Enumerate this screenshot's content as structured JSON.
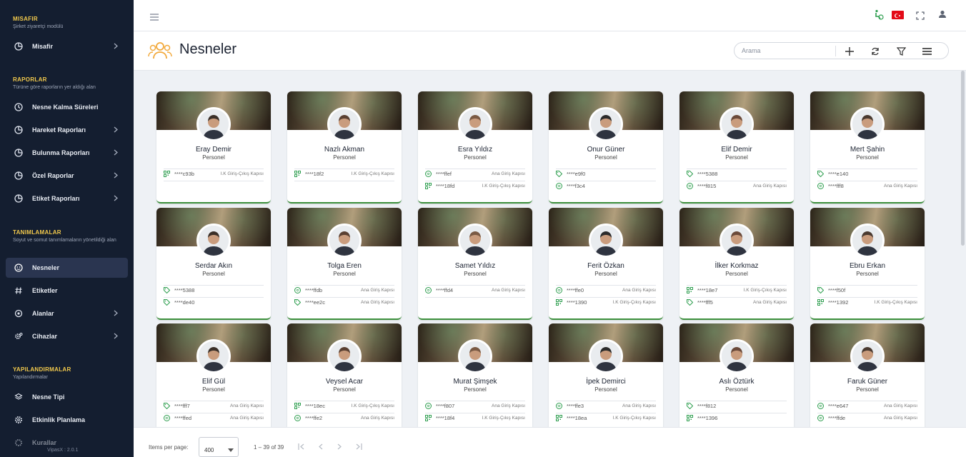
{
  "sidebar": {
    "sections": [
      {
        "title": "MISAFIR",
        "subtitle": "Şirket ziyaretçi modülü"
      },
      {
        "title": "RAPORLAR",
        "subtitle": "Türüne göre raporların yer aldığı alan"
      },
      {
        "title": "TANIMLAMALAR",
        "subtitle": "Soyut ve somut tanımlamaların yönetildiği alan"
      },
      {
        "title": "YAPILANDIRMALAR",
        "subtitle": "Yapılandırmalar"
      }
    ],
    "items": [
      {
        "label": "Misafir",
        "icon": "pie-chart-icon"
      },
      {
        "label": "Nesne Kalma Süreleri",
        "icon": "clock-icon"
      },
      {
        "label": "Hareket Raporları",
        "icon": "pie-chart-icon"
      },
      {
        "label": "Bulunma Raporları",
        "icon": "pie-chart-icon"
      },
      {
        "label": "Özel Raporlar",
        "icon": "pie-chart-icon"
      },
      {
        "label": "Etiket Raporları",
        "icon": "pie-chart-icon"
      },
      {
        "label": "Nesneler",
        "icon": "smile-icon"
      },
      {
        "label": "Etiketler",
        "icon": "hashtag-icon"
      },
      {
        "label": "Alanlar",
        "icon": "target-icon"
      },
      {
        "label": "Cihazlar",
        "icon": "gears-icon"
      },
      {
        "label": "Nesne Tipi",
        "icon": "layers-icon"
      },
      {
        "label": "Etkinlik Planlama",
        "icon": "gear-icon"
      },
      {
        "label": "Kurallar",
        "icon": "gear-icon"
      }
    ],
    "version": "VipasX : 2.0.1"
  },
  "header": {
    "title": "Nesneler",
    "search_placeholder": "Arama"
  },
  "cards": [
    {
      "name": "Eray Demir",
      "role": "Personel",
      "tags": [
        {
          "code": "****c93b",
          "loc": "I.K Giriş-Çıkış Kapısı",
          "icon": "qr-icon"
        }
      ]
    },
    {
      "name": "Nazlı Akman",
      "role": "Personel",
      "tags": [
        {
          "code": "****18f2",
          "loc": "I.K Giriş-Çıkış Kapısı",
          "icon": "qr-icon"
        }
      ]
    },
    {
      "name": "Esra Yıldız",
      "role": "Personel",
      "tags": [
        {
          "code": "****ffef",
          "loc": "Ana Giriş Kapısı",
          "icon": "wifi-icon"
        },
        {
          "code": "****18fd",
          "loc": "I.K Giriş-Çıkış Kapısı",
          "icon": "qr-icon"
        }
      ]
    },
    {
      "name": "Onur Güner",
      "role": "Personel",
      "tags": [
        {
          "code": "****e9f0",
          "loc": "",
          "icon": "tag-icon"
        },
        {
          "code": "****f3c4",
          "loc": "",
          "icon": "wifi-icon"
        }
      ]
    },
    {
      "name": "Elif Demir",
      "role": "Personel",
      "tags": [
        {
          "code": "****5388",
          "loc": "",
          "icon": "tag-icon"
        },
        {
          "code": "****f815",
          "loc": "Ana Giriş Kapısı",
          "icon": "wifi-icon"
        }
      ]
    },
    {
      "name": "Mert Şahin",
      "role": "Personel",
      "tags": [
        {
          "code": "****e140",
          "loc": "",
          "icon": "tag-icon"
        },
        {
          "code": "****fff8",
          "loc": "Ana Giriş Kapısı",
          "icon": "wifi-icon"
        }
      ]
    },
    {
      "name": "Serdar Akın",
      "role": "Personel",
      "tags": [
        {
          "code": "****5388",
          "loc": "",
          "icon": "tag-icon"
        },
        {
          "code": "****de40",
          "loc": "",
          "icon": "tag-icon"
        }
      ]
    },
    {
      "name": "Tolga Eren",
      "role": "Personel",
      "tags": [
        {
          "code": "****ffdb",
          "loc": "Ana Giriş Kapısı",
          "icon": "wifi-icon"
        },
        {
          "code": "****ee2c",
          "loc": "Ana Giriş Kapısı",
          "icon": "tag-icon"
        }
      ]
    },
    {
      "name": "Samet Yıldız",
      "role": "Personel",
      "tags": [
        {
          "code": "****ffd4",
          "loc": "Ana Giriş Kapısı",
          "icon": "wifi-icon"
        }
      ]
    },
    {
      "name": "Ferit Özkan",
      "role": "Personel",
      "tags": [
        {
          "code": "****ffe0",
          "loc": "Ana Giriş Kapısı",
          "icon": "wifi-icon"
        },
        {
          "code": "****1390",
          "loc": "I.K Giriş-Çıkış Kapısı",
          "icon": "qr-icon"
        }
      ]
    },
    {
      "name": "İlker Korkmaz",
      "role": "Personel",
      "tags": [
        {
          "code": "****18e7",
          "loc": "I.K Giriş-Çıkış Kapısı",
          "icon": "qr-icon"
        },
        {
          "code": "****fff5",
          "loc": "Ana Giriş Kapısı",
          "icon": "tag-icon"
        }
      ]
    },
    {
      "name": "Ebru Erkan",
      "role": "Personel",
      "tags": [
        {
          "code": "****f50f",
          "loc": "",
          "icon": "tag-icon"
        },
        {
          "code": "****1392",
          "loc": "I.K Giriş-Çıkış Kapısı",
          "icon": "qr-icon"
        }
      ]
    },
    {
      "name": "Elif Gül",
      "role": "Personel",
      "tags": [
        {
          "code": "****fff7",
          "loc": "Ana Giriş Kapısı",
          "icon": "tag-icon"
        },
        {
          "code": "****ffed",
          "loc": "Ana Giriş Kapısı",
          "icon": "wifi-icon"
        }
      ]
    },
    {
      "name": "Veysel  Acar",
      "role": "Personel",
      "tags": [
        {
          "code": "****18ec",
          "loc": "I.K Giriş-Çıkış Kapısı",
          "icon": "qr-icon"
        },
        {
          "code": "****ffe2",
          "loc": "Ana Giriş Kapısı",
          "icon": "wifi-icon"
        }
      ]
    },
    {
      "name": "Murat Şimşek",
      "role": "Personel",
      "tags": [
        {
          "code": "****f807",
          "loc": "Ana Giriş Kapısı",
          "icon": "wifi-icon"
        },
        {
          "code": "****18f4",
          "loc": "I.K Giriş-Çıkış Kapısı",
          "icon": "qr-icon"
        }
      ]
    },
    {
      "name": "İpek Demirci",
      "role": "Personel",
      "tags": [
        {
          "code": "****ffe3",
          "loc": "Ana Giriş Kapısı",
          "icon": "wifi-icon"
        },
        {
          "code": "****18ea",
          "loc": "I.K Giriş-Çıkış Kapısı",
          "icon": "qr-icon"
        }
      ]
    },
    {
      "name": "Aslı Öztürk",
      "role": "Personel",
      "tags": [
        {
          "code": "****f812",
          "loc": "",
          "icon": "tag-icon"
        },
        {
          "code": "****1396",
          "loc": "",
          "icon": "qr-icon"
        }
      ]
    },
    {
      "name": "Faruk  Güner",
      "role": "Personel",
      "tags": [
        {
          "code": "****e647",
          "loc": "Ana Giriş Kapısı",
          "icon": "wifi-icon"
        },
        {
          "code": "****ffde",
          "loc": "Ana Giriş Kapısı",
          "icon": "wifi-icon"
        }
      ]
    }
  ],
  "footer": {
    "items_per_page_label": "Items per page:",
    "items_per_page_value": "400",
    "range": "1 – 39 of 39"
  },
  "colors": {
    "sidebar_bg": "#141e30",
    "accent": "#f2c94c",
    "tag_green": "#3c8f3c"
  }
}
